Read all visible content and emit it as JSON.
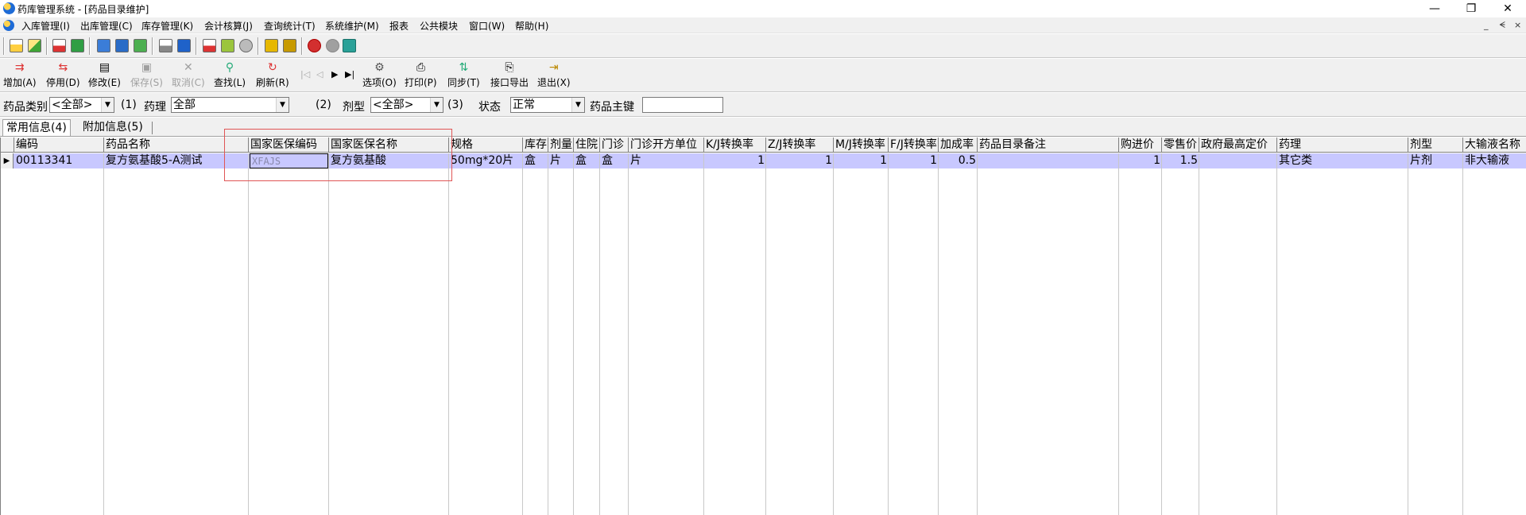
{
  "window": {
    "title": "药库管理系统 - [药品目录维护]",
    "minimize": "—",
    "restore": "❐",
    "close": "✕"
  },
  "menu": {
    "items": [
      "入库管理(I)",
      "出库管理(C)",
      "库存管理(K)",
      "会计核算(J)",
      "查询统计(T)",
      "系统维护(M)",
      "报表",
      "公共模块",
      "窗口(W)",
      "帮助(H)"
    ],
    "mdi_min": "_",
    "mdi_restore": "ᗕ",
    "mdi_close": "×"
  },
  "toolbar": {
    "add": "增加(A)",
    "disable": "停用(D)",
    "modify": "修改(E)",
    "save": "保存(S)",
    "cancel": "取消(C)",
    "find": "查找(L)",
    "refresh": "刷新(R)",
    "options": "选项(O)",
    "print": "打印(P)",
    "sync": "同步(T)",
    "export": "接口导出",
    "exit": "退出(X)"
  },
  "filters": {
    "category_label": "药品类别",
    "category_value": "<全部>",
    "hint1": "(1)",
    "pharmacology_label": "药理",
    "pharmacology_value": "全部",
    "hint2": "(2)",
    "dosage_label": "剂型",
    "dosage_value": "<全部>",
    "hint3": "(3)",
    "status_label": "状态",
    "status_value": "正常",
    "key_label": "药品主键",
    "key_value": ""
  },
  "tabs": [
    "常用信息(4)",
    "附加信息(5)"
  ],
  "grid": {
    "columns": [
      "编码",
      "药品名称",
      "国家医保编码",
      "国家医保名称",
      "规格",
      "库存",
      "剂量",
      "住院",
      "门诊",
      "门诊开方单位",
      "K/J转换率",
      "Z/J转换率",
      "M/J转换率",
      "F/J转换率",
      "加成率",
      "药品目录备注",
      "购进价",
      "零售价",
      "政府最高定价",
      "药理",
      "剂型",
      "大输液名称"
    ],
    "rows": [
      {
        "code": "00113341",
        "name": "复方氨基酸5-A测试",
        "nhsa_code": "XFAJS",
        "nhsa_name": "复方氨基酸",
        "spec": "50mg*20片",
        "stock_unit": "盒",
        "dose_unit": "片",
        "inpatient_unit": "盒",
        "outpatient_unit": "盒",
        "rx_unit": "片",
        "kj": "1",
        "zj": "1",
        "mj": "1",
        "fj": "1",
        "markup": "0.5",
        "remark": "",
        "purchase": "1",
        "retail": "1.5",
        "gov_max": "",
        "pharmacology": "其它类",
        "dosage": "片剂",
        "infusion": "非大输液"
      }
    ]
  }
}
